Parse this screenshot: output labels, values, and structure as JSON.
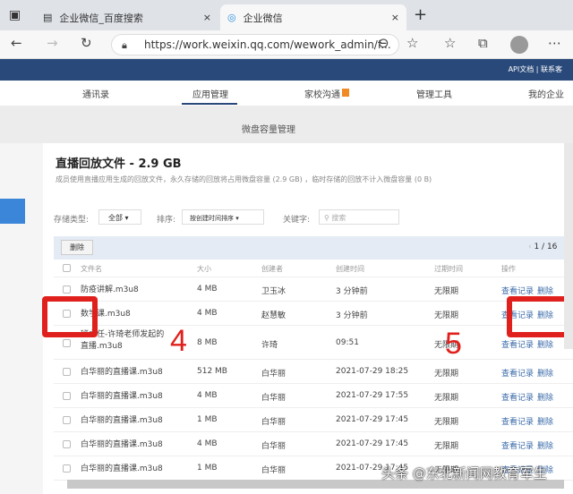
{
  "browser": {
    "tabs": [
      {
        "title": "企业微信_百度搜索"
      },
      {
        "title": "企业微信"
      }
    ],
    "url": "https://work.weixin.qq.com/wework_admin/f...",
    "new_tab": "+",
    "close": "×"
  },
  "header": {
    "links": "API文档 | 联系客"
  },
  "nav": {
    "items": [
      "通讯录",
      "应用管理",
      "家校沟通",
      "管理工具",
      "我的企业"
    ],
    "active": 1
  },
  "page": {
    "section_title": "微盘容量管理",
    "title": "直播回放文件 - 2.9 GB",
    "desc": "成员使用直播应用生成的回放文件，永久存储的回放将占用微盘容量 (2.9 GB) ，临时存储的回放不计入微盘容量 (0 B)"
  },
  "filters": {
    "type_label": "存储类型:",
    "type_value": "全部",
    "sort_label": "排序:",
    "sort_value": "按创建时间排序",
    "keyword_label": "关键字:",
    "search_placeholder": "搜索"
  },
  "toolbar": {
    "delete": "删除",
    "pagination": "1 / 16"
  },
  "table": {
    "columns": [
      "文件名",
      "大小",
      "创建者",
      "创建时间",
      "过期时间",
      "操作"
    ],
    "rows": [
      {
        "name": "防疫讲解.m3u8",
        "size": "4 MB",
        "creator": "卫玉冰",
        "created": "3 分钟前",
        "expire": "无限期"
      },
      {
        "name": "数学课.m3u8",
        "size": "4 MB",
        "creator": "赵慧敏",
        "created": "3 分钟前",
        "expire": "无限期"
      },
      {
        "name": "班主任-许琦老师发起的直播.m3u8",
        "size": "8 MB",
        "creator": "许琦",
        "created": "09:51",
        "expire": "无限期"
      },
      {
        "name": "白华丽的直播课.m3u8",
        "size": "512 MB",
        "creator": "白华丽",
        "created": "2021-07-29 18:25",
        "expire": "无限期"
      },
      {
        "name": "白华丽的直播课.m3u8",
        "size": "4 MB",
        "creator": "白华丽",
        "created": "2021-07-29 17:55",
        "expire": "无限期"
      },
      {
        "name": "白华丽的直播课.m3u8",
        "size": "1 MB",
        "creator": "白华丽",
        "created": "2021-07-29 17:45",
        "expire": "无限期"
      },
      {
        "name": "白华丽的直播课.m3u8",
        "size": "4 MB",
        "creator": "白华丽",
        "created": "2021-07-29 17:45",
        "expire": "无限期"
      },
      {
        "name": "白华丽的直播课.m3u8",
        "size": "1 MB",
        "creator": "白华丽",
        "created": "2021-07-29 17:45",
        "expire": "无限期"
      }
    ],
    "view": "查看记录",
    "del": "删除"
  },
  "annotations": {
    "n4": "4",
    "n5": "5"
  },
  "watermark": "头条 @东北新闻网教育军生"
}
